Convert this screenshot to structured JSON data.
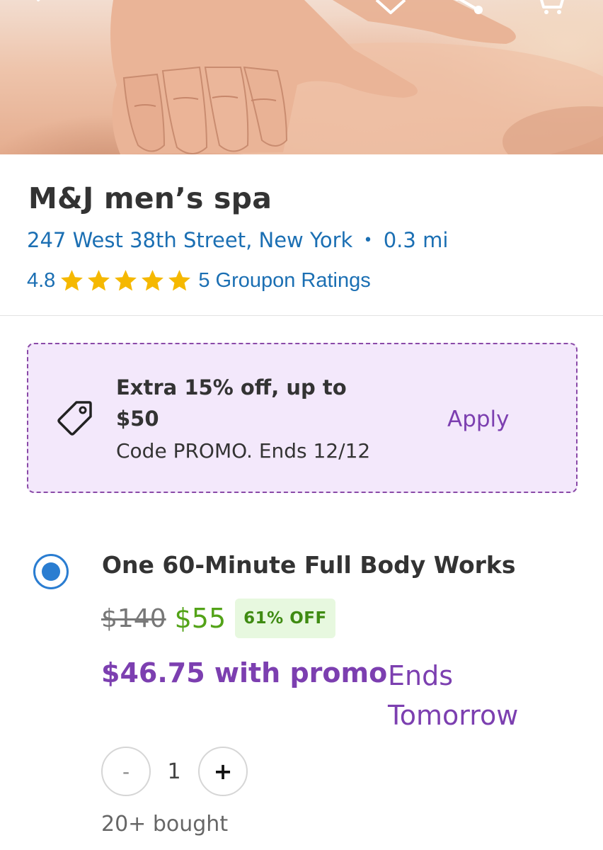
{
  "header_icons": [
    "back-arrow-icon",
    "heart-icon",
    "share-icon",
    "cart-icon"
  ],
  "merchant": {
    "name": "M&J men’s spa",
    "address": "247 West 38th Street, New York",
    "separator": "•",
    "distance": "0.3 mi",
    "rating": "4.8",
    "stars": 5,
    "ratings_label": "5 Groupon Ratings"
  },
  "promo": {
    "line1": "Extra 15% off, up to",
    "line2": "$50",
    "code_text": "Code PROMO. Ends 12/12",
    "apply_label": "Apply",
    "icon": "tag-icon"
  },
  "option": {
    "selected": true,
    "title": "One 60-Minute Full Body Works",
    "original_price": "$140",
    "price": "$55",
    "discount_badge": "61% OFF",
    "promo_price": "$46.75 with promo",
    "ends_line1": "Ends",
    "ends_line2": "Tomorrow",
    "quantity": {
      "minus": "-",
      "value": "1",
      "plus": "+"
    },
    "bought": "20+ bought"
  },
  "colors": {
    "link_blue": "#1b6fb3",
    "star": "#f5b800",
    "promo_purple": "#7c3fb0",
    "promo_bg": "#f3e8fb",
    "price_green": "#53a318",
    "radio_blue": "#2a7dd1"
  }
}
